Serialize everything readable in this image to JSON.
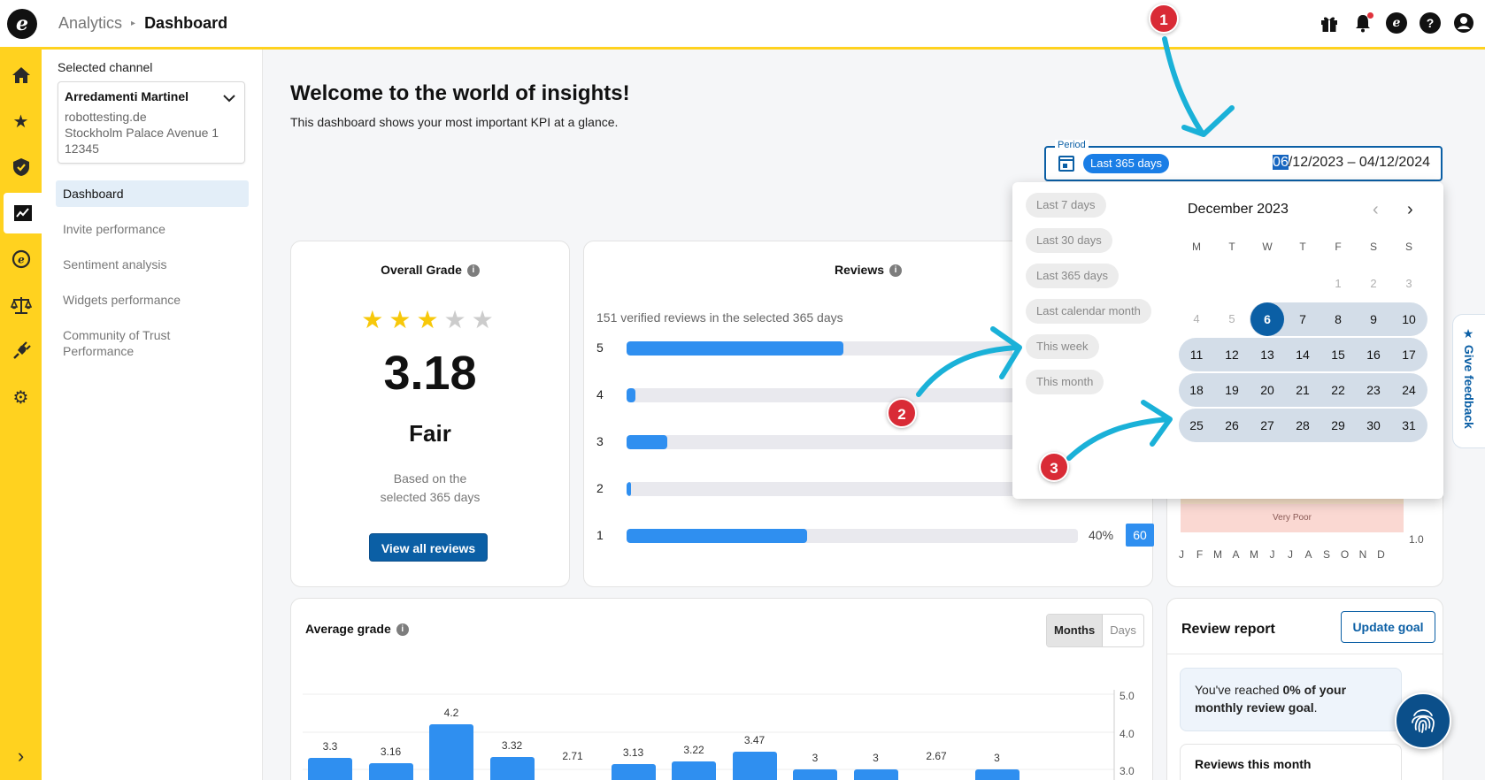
{
  "header": {
    "breadcrumb": [
      "Analytics",
      "Dashboard"
    ]
  },
  "rail": {
    "items": [
      "home-icon",
      "star-icon",
      "shield-icon",
      "chart-icon",
      "trustpilot-icon",
      "scale-icon",
      "plug-icon",
      "gear-icon"
    ]
  },
  "channel": {
    "label": "Selected channel",
    "name": "Arredamenti Martinel",
    "site": "robottesting.de",
    "address": "Stockholm Palace Avenue 1",
    "zip": "12345"
  },
  "subnav": [
    "Dashboard",
    "Invite performance",
    "Sentiment analysis",
    "Widgets performance",
    "Community of Trust Performance"
  ],
  "main": {
    "title": "Welcome to the world of insights!",
    "subtitle": "This dashboard shows your most important KPI at a glance."
  },
  "period": {
    "label": "Period",
    "chip": "Last 365 days",
    "start_highlight": "06",
    "dates_rest": "/12/2023 – 04/12/2024"
  },
  "overall": {
    "title": "Overall Grade",
    "stars_filled": 3,
    "stars_total": 5,
    "grade": "3.18",
    "word": "Fair",
    "based_1": "Based on the",
    "based_2": "selected 365 days",
    "button": "View all reviews"
  },
  "reviews": {
    "title": "Reviews",
    "summary": "151 verified reviews in the selected 365 days",
    "rows": [
      {
        "star": "5",
        "fill": 0.48
      },
      {
        "star": "4",
        "fill": 0.02
      },
      {
        "star": "3",
        "fill": 0.09
      },
      {
        "star": "2",
        "fill": 0.01
      },
      {
        "star": "1",
        "fill": 0.4,
        "pct": "40%",
        "count": "60"
      }
    ]
  },
  "datepicker": {
    "presets": [
      "Last 7 days",
      "Last 30 days",
      "Last 365 days",
      "Last calendar month",
      "This week",
      "This month"
    ],
    "month": "December 2023",
    "weekdays": [
      "M",
      "T",
      "W",
      "T",
      "F",
      "S",
      "S"
    ],
    "weeks": [
      [
        "",
        "",
        "",
        "",
        "1",
        "2",
        "3"
      ],
      [
        "4",
        "5",
        "6",
        "7",
        "8",
        "9",
        "10"
      ],
      [
        "11",
        "12",
        "13",
        "14",
        "15",
        "16",
        "17"
      ],
      [
        "18",
        "19",
        "20",
        "21",
        "22",
        "23",
        "24"
      ],
      [
        "25",
        "26",
        "27",
        "28",
        "29",
        "30",
        "31"
      ]
    ],
    "selected": "6"
  },
  "trend": {
    "band_label": "Very Poor",
    "y_min": "1.0",
    "months": [
      "J",
      "F",
      "M",
      "A",
      "M",
      "J",
      "J",
      "A",
      "S",
      "O",
      "N",
      "D"
    ],
    "colors": {
      "poor": "#fad8d2",
      "fair": "#f7e0c8"
    }
  },
  "avg": {
    "title": "Average grade",
    "toggle": [
      "Months",
      "Days"
    ],
    "y_ticks": [
      "5.0",
      "4.0",
      "3.0"
    ],
    "values": [
      "3.3",
      "3.16",
      "4.2",
      "3.32",
      "2.71",
      "3.13",
      "3.22",
      "3.47",
      "3",
      "3",
      "2.67",
      "3"
    ]
  },
  "report": {
    "title": "Review report",
    "button": "Update goal",
    "goal_pre": "You've reached ",
    "goal_bold": "0% of your monthly review goal",
    "goal_post": ".",
    "month_title": "Reviews this month"
  },
  "feedback": {
    "label": "Give feedback"
  },
  "annotations": [
    "1",
    "2",
    "3"
  ],
  "colors": {
    "brand_yellow": "#ffd21f",
    "primary": "#0b5fa5",
    "bar": "#2f8ff0",
    "annotation": "#d92b36",
    "arrow": "#1ab1d8"
  }
}
